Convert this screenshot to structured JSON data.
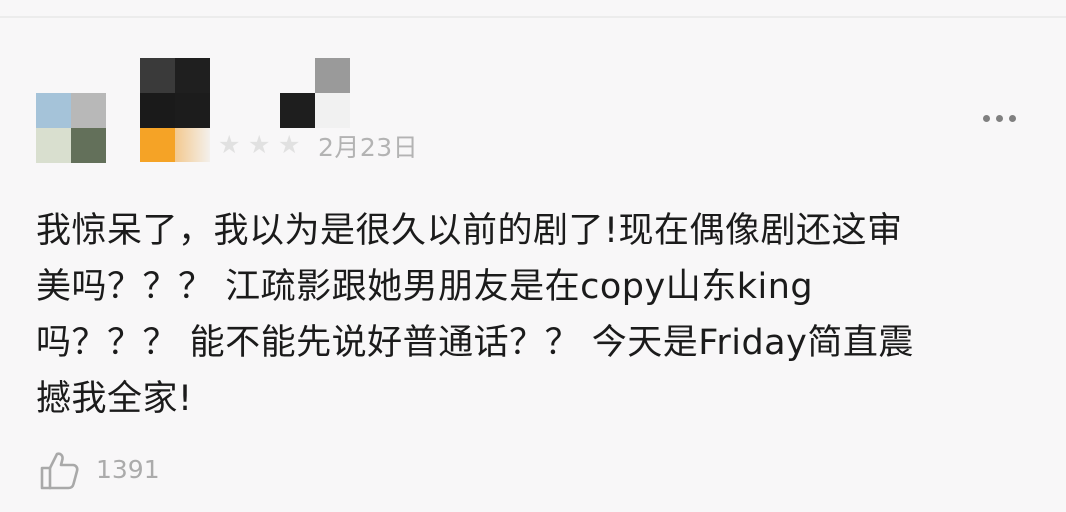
{
  "review": {
    "date": "2月23日",
    "rating_icon": "star-icon",
    "star_glyph": "★",
    "more_icon": "more-dots-icon",
    "comment_lines": [
      "我惊呆了，我以为是很久以前的剧了!现在偶像剧还这审",
      "美吗？？？ 江疏影跟她男朋友是在copy山东king",
      "吗？？？ 能不能先说好普通话？？ 今天是Friday简直震",
      "撼我全家!"
    ],
    "like_icon": "thumbs-up-icon",
    "like_count": "1391"
  },
  "colors": {
    "background": "#f8f7f8",
    "text": "#1b1b1b",
    "muted": "#b3b3b3",
    "star_active": "#f5a326",
    "star_inactive": "#e1e1e1"
  }
}
